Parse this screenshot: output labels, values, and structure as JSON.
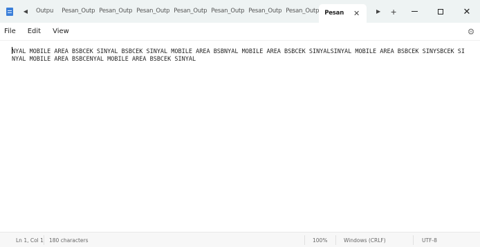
{
  "window": {
    "title": "Pesan",
    "tabs": [
      {
        "label": "Outpu"
      },
      {
        "label": "Pesan_Outpu"
      },
      {
        "label": "Pesan_Outpu"
      },
      {
        "label": "Pesan_Outpu"
      },
      {
        "label": "Pesan_Outpu"
      },
      {
        "label": "Pesan_Outpu"
      },
      {
        "label": "Pesan_Outpu"
      },
      {
        "label": "Pesan_Outpu"
      }
    ],
    "active_tab": {
      "label": "Pesan",
      "close": "✕"
    },
    "tab_prev_glyph": "◀",
    "tab_next_glyph": "▶",
    "new_tab_glyph": "+",
    "close_glyph": "✕"
  },
  "menu": {
    "file": "File",
    "edit": "Edit",
    "view": "View",
    "settings_glyph": "⚙"
  },
  "editor": {
    "text": "NYAL MOBILE AREA BSBCEK SINYAL BSBCEK SINYAL MOBILE AREA BSBNYAL MOBILE AREA BSBCEK SINYALSINYAL MOBILE AREA BSBCEK SINYSBCEK SINYAL MOBILE AREA BSBCENYAL MOBILE AREA BSBCEK SINYAL"
  },
  "status": {
    "position": "Ln 1, Col 1",
    "characters": "180 characters",
    "zoom": "100%",
    "line_ending": "Windows (CRLF)",
    "encoding": "UTF-8"
  },
  "colors": {
    "titlebar": "#eef3f3",
    "app_icon": "#3b7fd9",
    "statusbar": "#f7f7f7"
  }
}
